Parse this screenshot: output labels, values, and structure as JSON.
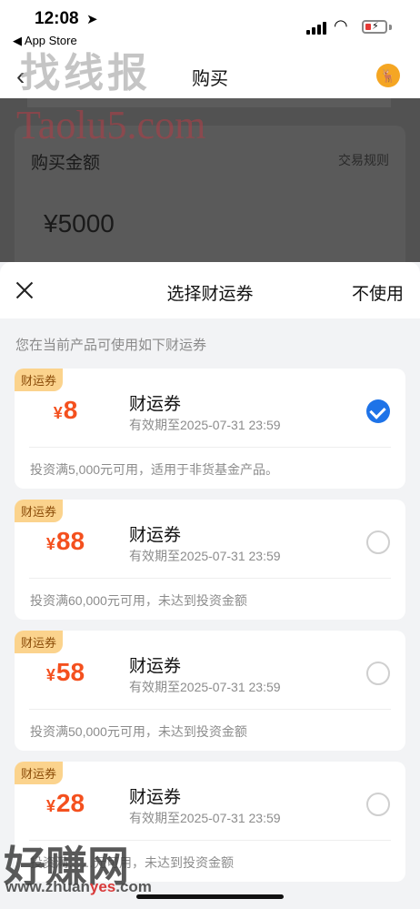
{
  "status_bar": {
    "time": "12:08",
    "back_app": "◀ App Store"
  },
  "app": {
    "title": "购买",
    "purchase_label": "购买金额",
    "rules_link": "交易规则",
    "amount": "¥5000"
  },
  "sheet": {
    "title": "选择财运券",
    "no_use": "不使用",
    "hint": "您在当前产品可使用如下财运券",
    "coupons": [
      {
        "tag": "财运券",
        "currency": "¥",
        "value": "8",
        "name": "财运券",
        "expire": "有效期至2025-07-31 23:59",
        "note": "投资满5,000元可用，适用于非货基金产品。",
        "selected": true
      },
      {
        "tag": "财运券",
        "currency": "¥",
        "value": "88",
        "name": "财运券",
        "expire": "有效期至2025-07-31 23:59",
        "note": "投资满60,000元可用，未达到投资金额",
        "selected": false
      },
      {
        "tag": "财运券",
        "currency": "¥",
        "value": "58",
        "name": "财运券",
        "expire": "有效期至2025-07-31 23:59",
        "note": "投资满50,000元可用，未达到投资金额",
        "selected": false
      },
      {
        "tag": "财运券",
        "currency": "¥",
        "value": "28",
        "name": "财运券",
        "expire": "有效期至2025-07-31 23:59",
        "note": "投资满……元可用，未达到投资金额",
        "selected": false
      }
    ]
  },
  "watermarks": {
    "top": "找线报",
    "url": "Taolu5.com",
    "bottom": "好赚网",
    "bottom_url_a": "www.zhuan",
    "bottom_url_b": "yes",
    "bottom_url_c": ".com"
  },
  "colors": {
    "accent_blue": "#1e73e8",
    "coupon_red": "#f4501e",
    "tag_bg": "#fbd38d"
  }
}
